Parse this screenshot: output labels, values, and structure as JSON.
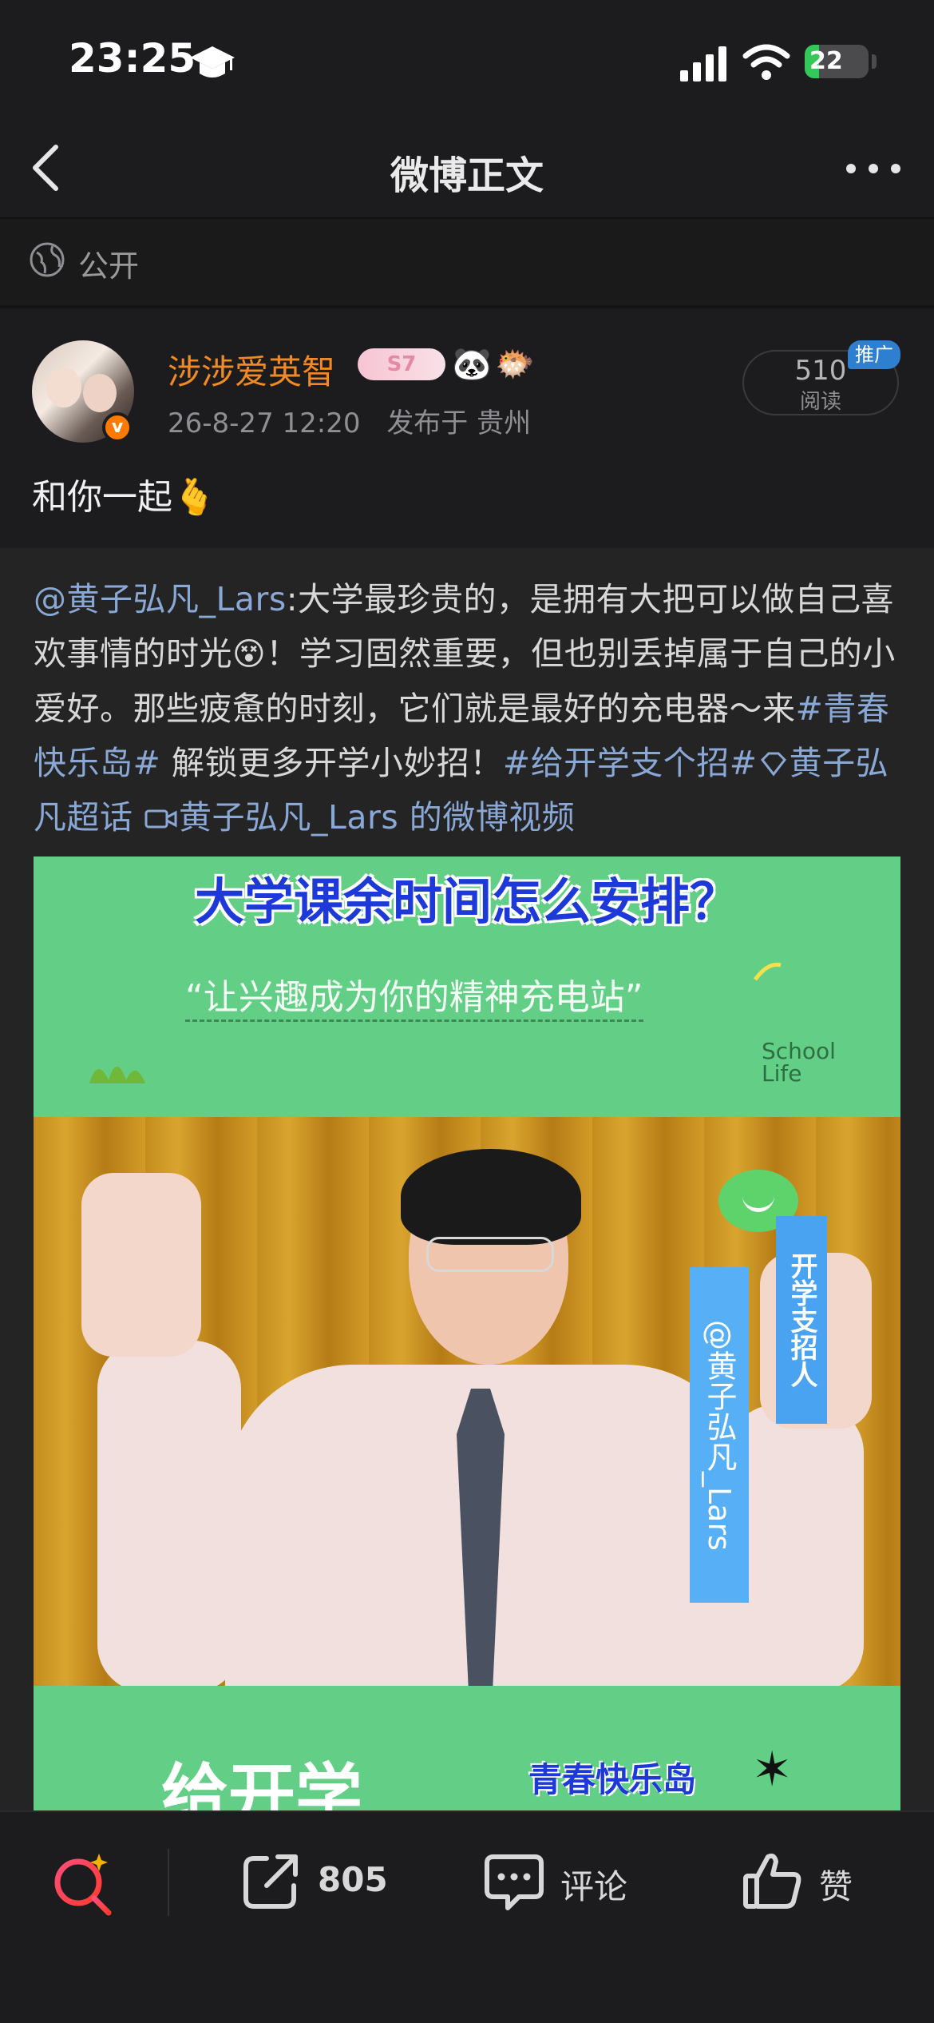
{
  "status_bar": {
    "time": "23:25",
    "battery": "22",
    "battery_level": 0.22
  },
  "nav": {
    "title": "微博正文"
  },
  "visibility": {
    "label": "公开"
  },
  "post": {
    "author": "涉涉爱英智",
    "author_badge": "S7",
    "timestamp": "26-8-27 12:20",
    "location": "发布于 贵州",
    "read_count": "510",
    "read_label": "阅读",
    "promo_tag": "推广",
    "text": "和你一起",
    "text_emoji": "🫰"
  },
  "repost": {
    "mention": "@黄子弘凡_Lars",
    "body_1": ":大学最珍贵的，是拥有大把可以做自己喜欢事情的时光",
    "emoji": "😵",
    "body_2": "！学习固然重要，但也别丢掉属于自己的小爱好。那些疲惫的时刻，它们就是最好的充电器～来",
    "topic_1": "#青春快乐岛#",
    "body_3": " 解锁更多开学小妙招！",
    "topic_2": "#给开学支个招#",
    "super_topic": "黄子弘凡超话",
    "video_link": "黄子弘凡_Lars 的微博视频"
  },
  "video": {
    "headline": "大学课余时间怎么安排？",
    "subtitle": "“让兴趣成为你的精神充电站”",
    "school_life_1": "School",
    "school_life_2": "Life",
    "tape_1": "开学支招人",
    "tape_2": "@黄子弘凡_Lars",
    "bottom_title": "给开学",
    "bottom_sub": "青春快乐岛"
  },
  "toolbar": {
    "share_count": "805",
    "comment_label": "评论",
    "like_label": "赞"
  },
  "colors": {
    "background": "#1c1c1e",
    "author_orange": "#f08a24",
    "link_blue": "#8aa8d6",
    "video_green": "#63cf86",
    "headline_blue": "#1d3ad8"
  }
}
